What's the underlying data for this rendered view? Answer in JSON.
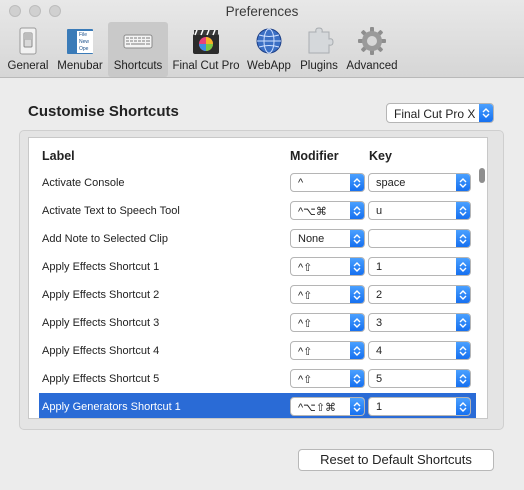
{
  "window": {
    "title": "Preferences"
  },
  "toolbar": {
    "items": [
      {
        "label": "General"
      },
      {
        "label": "Menubar",
        "icon_text": [
          "File",
          "New",
          "Ope"
        ]
      },
      {
        "label": "Shortcuts"
      },
      {
        "label": "Final Cut Pro"
      },
      {
        "label": "WebApp"
      },
      {
        "label": "Plugins"
      },
      {
        "label": "Advanced"
      }
    ],
    "selected": "Shortcuts"
  },
  "main": {
    "title": "Customise Shortcuts",
    "app_select": {
      "value": "Final Cut Pro X"
    }
  },
  "table": {
    "columns": {
      "label": "Label",
      "modifier": "Modifier",
      "key": "Key"
    },
    "rows": [
      {
        "label": "Activate Console",
        "modifier": "^",
        "key": "space"
      },
      {
        "label": "Activate Text to Speech Tool",
        "modifier": "^⌥⌘",
        "key": "u"
      },
      {
        "label": "Add Note to Selected Clip",
        "modifier": "None",
        "key": ""
      },
      {
        "label": "Apply Effects Shortcut 1",
        "modifier": "^⇧",
        "key": "1"
      },
      {
        "label": "Apply Effects Shortcut 2",
        "modifier": "^⇧",
        "key": "2"
      },
      {
        "label": "Apply Effects Shortcut 3",
        "modifier": "^⇧",
        "key": "3"
      },
      {
        "label": "Apply Effects Shortcut 4",
        "modifier": "^⇧",
        "key": "4"
      },
      {
        "label": "Apply Effects Shortcut 5",
        "modifier": "^⇧",
        "key": "5"
      },
      {
        "label": "Apply Generators Shortcut 1",
        "modifier": "^⌥⇧⌘",
        "key": "1"
      }
    ],
    "selected_row": "Apply Generators Shortcut 1"
  },
  "footer": {
    "reset_label": "Reset to Default Shortcuts"
  },
  "colors": {
    "accent": "#1670f0",
    "selection": "#2a6bd6"
  }
}
